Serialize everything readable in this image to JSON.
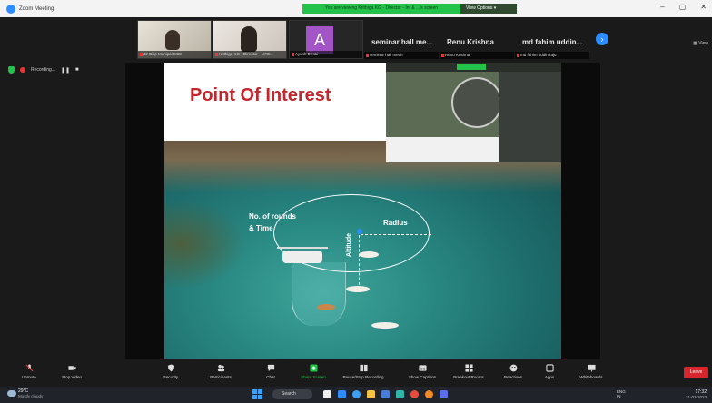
{
  "window": {
    "app_title": "Zoom Meeting",
    "banner_message": "You are viewing Krithiga KG - Director - Int & ...'s screen",
    "view_options": "View Options",
    "controls": [
      "–",
      "▢",
      "✕"
    ]
  },
  "participants": [
    {
      "name": "J2 Dilip Manipal ECE",
      "type": "video"
    },
    {
      "name": "Krithiga KG - Director - LIFE...",
      "type": "video"
    },
    {
      "name": "Ayush Desai",
      "initial": "A",
      "type": "avatar"
    },
    {
      "display": "seminar hall me...",
      "name": "seminar hall mech",
      "type": "name"
    },
    {
      "display": "Renu Krishna",
      "name": "Renu Krishna",
      "type": "name"
    },
    {
      "display": "md fahim uddin...",
      "name": "md fahim uddin raju",
      "type": "name"
    }
  ],
  "view_label": "View",
  "recording": {
    "label": "Recording...",
    "pause": "❚❚",
    "stop": "■"
  },
  "slide": {
    "title": "Point Of Interest",
    "label_rounds": "No. of rounds",
    "label_time": "& Time",
    "label_radius": "Radius",
    "label_altitude": "Altitude"
  },
  "toolbar": [
    {
      "id": "unmute",
      "label": "Unmute",
      "icon": "microphone-icon"
    },
    {
      "id": "stop-video",
      "label": "Stop Video",
      "icon": "camera-icon"
    },
    {
      "id": "security",
      "label": "Security",
      "icon": "shield-icon"
    },
    {
      "id": "participants",
      "label": "Participants",
      "icon": "people-icon",
      "count": "10"
    },
    {
      "id": "chat",
      "label": "Chat",
      "icon": "chat-icon"
    },
    {
      "id": "share",
      "label": "Share Screen",
      "icon": "share-icon"
    },
    {
      "id": "recording",
      "label": "Pause/Stop Recording",
      "icon": "record-icon"
    },
    {
      "id": "captions",
      "label": "Show Captions",
      "icon": "cc-icon"
    },
    {
      "id": "breakout",
      "label": "Breakout Rooms",
      "icon": "grid-icon"
    },
    {
      "id": "reactions",
      "label": "Reactions",
      "icon": "smile-icon"
    },
    {
      "id": "apps",
      "label": "Apps",
      "icon": "apps-icon"
    },
    {
      "id": "whiteboards",
      "label": "Whiteboards",
      "icon": "whiteboard-icon"
    }
  ],
  "end_button": "Leave",
  "taskbar": {
    "temperature": "29°C",
    "condition": "Mostly cloudy",
    "search": "Search",
    "lang": "ENG\nIN",
    "time": "17:32",
    "date": "31-03-2023"
  },
  "colors": {
    "accent": "#2d8cff",
    "banner": "#23c24b",
    "title_red": "#c1272d",
    "end": "#d9252e"
  }
}
